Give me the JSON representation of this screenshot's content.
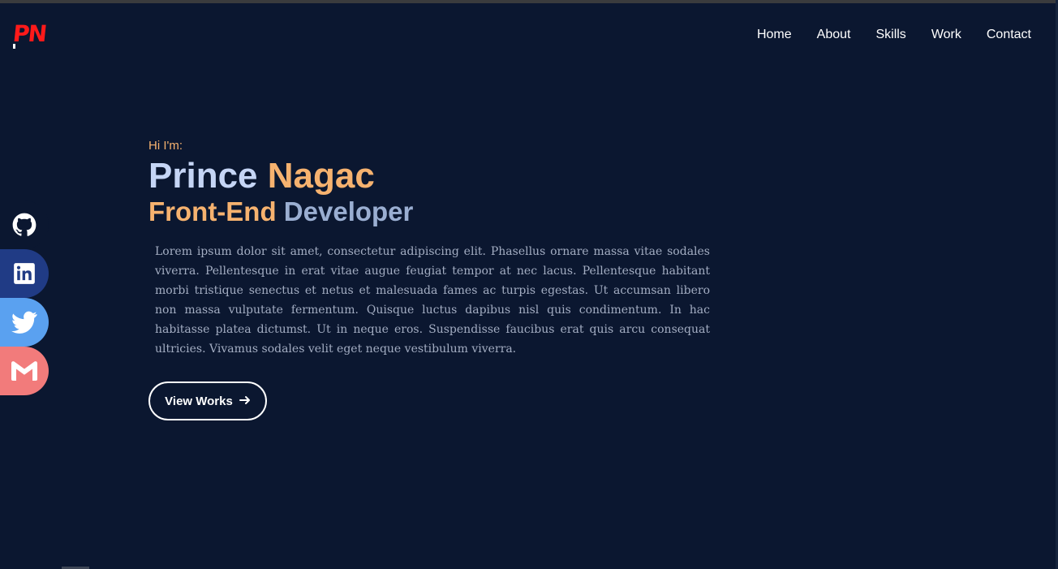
{
  "brand": {
    "logo_text": "PN",
    "logo_color": "#ff1a1a"
  },
  "nav": {
    "items": [
      "Home",
      "About",
      "Skills",
      "Work",
      "Contact"
    ]
  },
  "hero": {
    "greeting": "Hi I'm:",
    "first_name": "Prince",
    "last_name": "Nagac",
    "role_part1": "Front-End",
    "role_part2": "Developer",
    "description": "Lorem ipsum dolor sit amet, consectetur adipiscing elit. Phasellus ornare massa vitae sodales viverra. Pellentesque in erat vitae augue feugiat tempor at nec lacus. Pellentesque habitant morbi tristique senectus et netus et malesuada fames ac turpis egestas. Ut accumsan libero non massa vulputate fermentum. Quisque luctus dapibus nisl quis condimentum. In hac habitasse platea dictumst. Ut in neque eros. Suspendisse faucibus erat quis arcu consequat ultricies. Vivamus sodales velit eget neque vestibulum viverra.",
    "cta_label": "View Works",
    "cta_icon": "arrow-right-icon"
  },
  "social": [
    {
      "name": "github-icon",
      "color": "#0b1730"
    },
    {
      "name": "linkedin-icon",
      "color": "#203b85"
    },
    {
      "name": "twitter-icon",
      "color": "#5aa1f0"
    },
    {
      "name": "gmail-icon",
      "color": "#f27b7b"
    }
  ],
  "colors": {
    "background": "#0b1730",
    "accent": "#f6b26f",
    "name_light": "#c5d5f5",
    "muted_blue": "#9aaed1"
  }
}
